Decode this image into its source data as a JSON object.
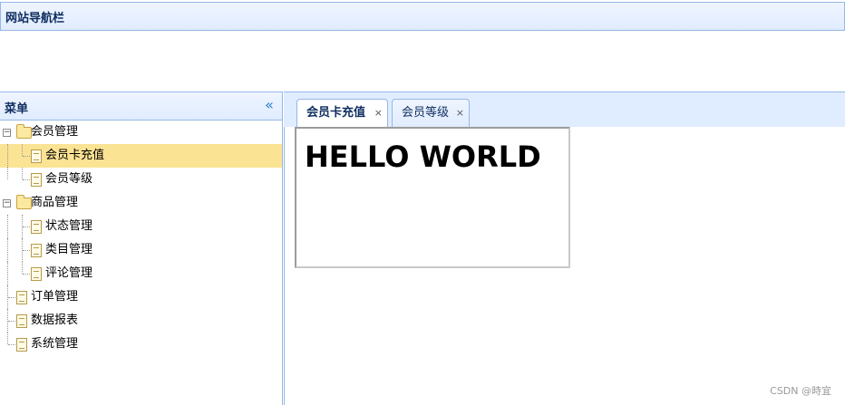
{
  "north": {
    "title": "网站导航栏"
  },
  "west": {
    "title": "菜单",
    "collapse_icon": "double-chevron-left-icon",
    "tree": [
      {
        "label": "会员管理",
        "type": "folder",
        "expanded": true,
        "children": [
          {
            "label": "会员卡充值",
            "type": "file",
            "selected": true
          },
          {
            "label": "会员等级",
            "type": "file"
          }
        ]
      },
      {
        "label": "商品管理",
        "type": "folder",
        "expanded": true,
        "children": [
          {
            "label": "状态管理",
            "type": "file"
          },
          {
            "label": "类目管理",
            "type": "file"
          },
          {
            "label": "评论管理",
            "type": "file"
          }
        ]
      },
      {
        "label": "订单管理",
        "type": "file"
      },
      {
        "label": "数据报表",
        "type": "file"
      },
      {
        "label": "系统管理",
        "type": "file"
      }
    ]
  },
  "center": {
    "tabs": [
      {
        "label": "会员卡充值",
        "close": "×",
        "active": true
      },
      {
        "label": "会员等级",
        "close": "×",
        "active": false
      }
    ],
    "content": {
      "heading": "HELLO WORLD"
    }
  },
  "watermark": "CSDN @時宜",
  "colors": {
    "border": "#95b8e7",
    "header_bg": "#e0ecff",
    "selected_bg": "#fbe394",
    "title_text": "#0e2d5f"
  }
}
